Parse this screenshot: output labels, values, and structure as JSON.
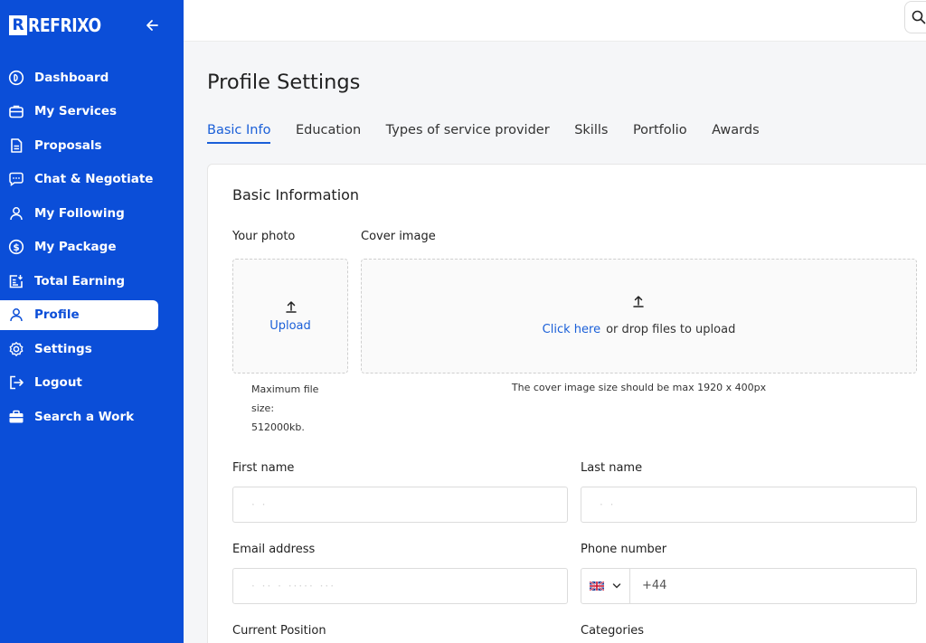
{
  "brand": {
    "logo_text": "REFRIXO"
  },
  "sidebar": {
    "items": [
      {
        "label": "Dashboard",
        "icon": "dashboard-icon"
      },
      {
        "label": "My Services",
        "icon": "briefcase-icon"
      },
      {
        "label": "Proposals",
        "icon": "document-icon"
      },
      {
        "label": "Chat & Negotiate",
        "icon": "chat-icon"
      },
      {
        "label": "My Following",
        "icon": "user-icon"
      },
      {
        "label": "My Package",
        "icon": "dollar-icon"
      },
      {
        "label": "Total Earning",
        "icon": "earning-icon"
      },
      {
        "label": "Profile",
        "icon": "user-icon",
        "active": true
      },
      {
        "label": "Settings",
        "icon": "gear-icon"
      },
      {
        "label": "Logout",
        "icon": "logout-icon"
      },
      {
        "label": "Search a Work",
        "icon": "toolbox-icon"
      }
    ]
  },
  "page": {
    "title": "Profile Settings"
  },
  "tabs": [
    {
      "label": "Basic Info",
      "active": true
    },
    {
      "label": "Education"
    },
    {
      "label": "Types of service provider"
    },
    {
      "label": "Skills"
    },
    {
      "label": "Portfolio"
    },
    {
      "label": "Awards"
    }
  ],
  "form": {
    "section_title": "Basic Information",
    "photo": {
      "label": "Your photo",
      "upload_label": "Upload",
      "hint_line1": "Maximum file",
      "hint_line2": "size:",
      "hint_line3": "512000kb."
    },
    "cover": {
      "label": "Cover image",
      "link": "Click here",
      "text": "or drop files to upload",
      "hint": "The cover image size should be max 1920 x 400px"
    },
    "first_name": {
      "label": "First name",
      "value": "· ·"
    },
    "last_name": {
      "label": "Last name",
      "value": "· ·"
    },
    "email": {
      "label": "Email address",
      "value": "·   ··   ·   ·····  ···"
    },
    "phone": {
      "label": "Phone number",
      "value": "+44",
      "country": "GB"
    },
    "current_position": {
      "label": "Current Position"
    },
    "categories": {
      "label": "Categories"
    }
  },
  "colors": {
    "primary": "#0b4ed8",
    "link": "#1a5fd8"
  }
}
